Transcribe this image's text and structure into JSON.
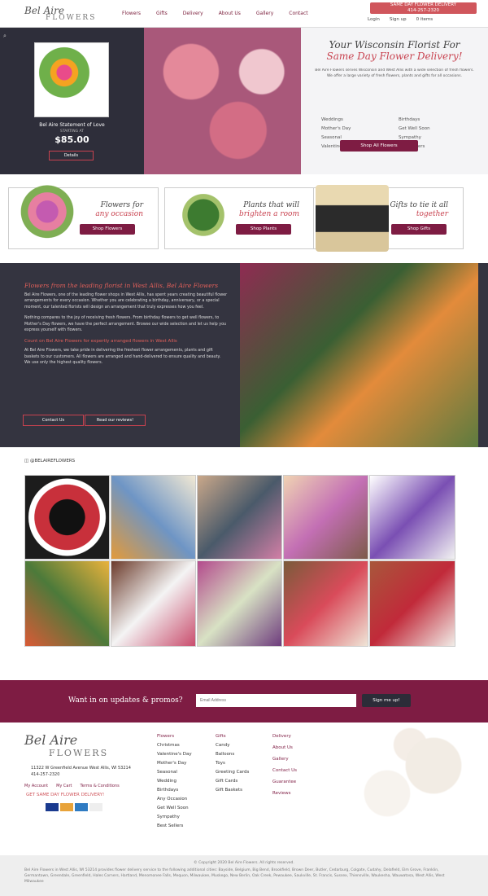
{
  "header": {
    "logo_line1": "Bel Aire",
    "logo_line2": "FLOWERS",
    "nav": [
      "Flowers",
      "Gifts",
      "Delivery",
      "About Us",
      "Gallery",
      "Contact"
    ],
    "promo_line1": "SAME DAY FLOWER DELIVERY",
    "promo_line2": "414-257-2320",
    "login": "Login",
    "signup": "Sign up",
    "cart": "0 items"
  },
  "hero": {
    "product_name": "Bel Aire Statement of Love",
    "price_label": "STARTING AT",
    "price": "$85.00",
    "details_btn": "Details",
    "title_line1": "Your Wisconsin Florist For",
    "title_line2": "Same Day Flower Delivery!",
    "intro": "Bel Aire Flowers serves Wisconsin and West Allis with a wide selection of fresh flowers. We offer a large variety of fresh flowers, plants and gifts for all occasions.",
    "occasions": [
      "Weddings",
      "Birthdays",
      "Mother's Day",
      "Get Well Soon",
      "Seasonal",
      "Sympathy",
      "Valentine's Day",
      "Best Sellers"
    ],
    "shop_btn": "Shop All Flowers"
  },
  "categories": [
    {
      "title1": "Flowers for",
      "title2": "any occasion",
      "btn": "Shop Flowers"
    },
    {
      "title1": "Plants that will",
      "title2": "brighten a room",
      "btn": "Shop Plants"
    },
    {
      "title1": "Gifts to tie it all",
      "title2": "together",
      "btn": "Shop Gifts"
    }
  ],
  "about": {
    "title": "Flowers from the leading florist in West Allis, Bel Aire Flowers",
    "p1": "Bel Aire Flowers, one of the leading flower shops in West Allis, has spent years creating beautiful flower arrangements for every occasion. Whether you are celebrating a birthday, anniversary, or a special moment, our talented florists will design an arrangement that truly expresses how you feel.",
    "p2": "Nothing compares to the joy of receiving fresh flowers. From birthday flowers to get well flowers, to Mother's Day flowers, we have the perfect arrangement. Browse our wide selection and let us help you express yourself with flowers.",
    "subtitle": "Count on Bel Aire Flowers for expertly arranged flowers in West Allis",
    "p3": "At Bel Aire Flowers, we take pride in delivering the freshest flower arrangements, plants and gift baskets to our customers. All flowers are arranged and hand-delivered to ensure quality and beauty. We use only the highest quality flowers.",
    "contact_btn": "Contact Us",
    "reviews_btn": "Read our reviews!"
  },
  "instagram": {
    "label": "@BELAIREFLOWERS"
  },
  "newsletter": {
    "title": "Want in on updates & promos?",
    "placeholder": "Email Address",
    "btn": "Sign me up!"
  },
  "footer": {
    "address": "11322 W Greenfield Avenue West Allis, WI 53214",
    "phone": "414-257-2320",
    "links": [
      "My Account",
      "My Cart",
      "Terms & Conditions"
    ],
    "same_day": "GET SAME DAY FLOWER DELIVERY!",
    "col1": [
      "Flowers",
      "Christmas",
      "Valentine's Day",
      "Mother's Day",
      "Seasonal",
      "Wedding",
      "Birthdays",
      "Any Occasion",
      "Get Well Soon",
      "Sympathy",
      "Best Sellers"
    ],
    "col2": [
      "Gifts",
      "Candy",
      "Balloons",
      "Toys",
      "Greeting Cards",
      "Gift Cards",
      "Gift Baskets"
    ],
    "col3": [
      "Delivery",
      "About Us",
      "Gallery",
      "Contact Us",
      "Guarantee",
      "Reviews"
    ]
  },
  "copyright": "© Copyright 2020 Bel Aire Flowers. All rights reserved.",
  "bottom_text": "Bel Aire Flowers in West Allis, WI 53214 provides flower delivery service to the following additional cities: Bayside, Belgium, Big Bend, Brookfield, Brown Deer, Butler, Cedarburg, Colgate, Cudahy, Delafield, Elm Grove, Franklin, Germantown, Greendale, Greenfield, Hales Corners, Hartland, Menomonee Falls, Mequon, Milwaukee, Muskego, New Berlin, Oak Creek, Pewaukee, Saukville, St. Francis, Sussex, Thiensville, Waukesha, Wauwatosa, West Allis, West Milwaukee"
}
